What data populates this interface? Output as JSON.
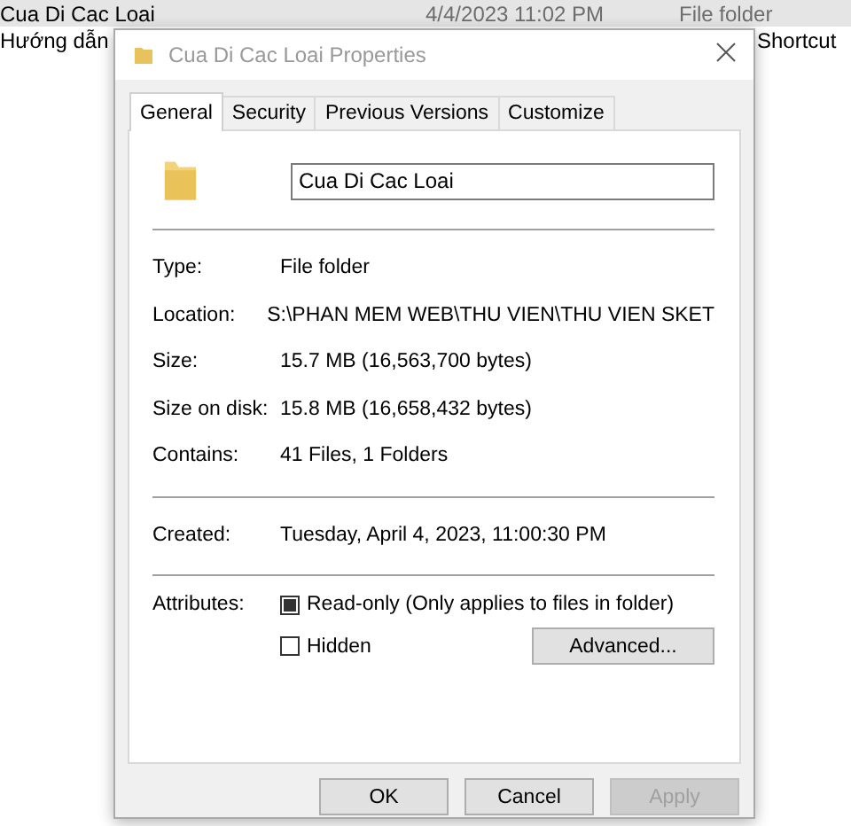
{
  "background": {
    "rows": [
      {
        "name": "Cua Di Cac Loai",
        "date": "4/4/2023 11:02 PM",
        "type": "File folder",
        "selected": true
      },
      {
        "name": "Hướng dẫn",
        "type": "Shortcut",
        "selected": false
      }
    ]
  },
  "dialog": {
    "title": "Cua Di Cac Loai Properties",
    "tabs": [
      {
        "label": "General",
        "selected": true
      },
      {
        "label": "Security",
        "selected": false
      },
      {
        "label": "Previous Versions",
        "selected": false
      },
      {
        "label": "Customize",
        "selected": false
      }
    ],
    "name_field": {
      "value": "Cua Di Cac Loai"
    },
    "groups": [
      [
        {
          "label": "Type:",
          "value": "File folder"
        },
        {
          "label": "Location:",
          "value": "S:\\PHAN MEM WEB\\THU VIEN\\THU VIEN SKET"
        },
        {
          "label": "Size:",
          "value": "15.7 MB (16,563,700 bytes)"
        },
        {
          "label": "Size on disk:",
          "value": "15.8 MB (16,658,432 bytes)"
        },
        {
          "label": "Contains:",
          "value": "41 Files, 1 Folders"
        }
      ],
      [
        {
          "label": "Created:",
          "value": "Tuesday, April 4, 2023, 11:00:30 PM"
        }
      ]
    ],
    "attributes": {
      "label": "Attributes:",
      "items": [
        {
          "label": "Read-only (Only applies to files in folder)",
          "checked": false,
          "indeterminate": true
        },
        {
          "label": "Hidden",
          "checked": false,
          "indeterminate": false
        }
      ],
      "advanced": "Advanced..."
    },
    "buttons": [
      {
        "label": "OK",
        "disabled": false
      },
      {
        "label": "Cancel",
        "disabled": false
      },
      {
        "label": "Apply",
        "disabled": true
      }
    ]
  }
}
